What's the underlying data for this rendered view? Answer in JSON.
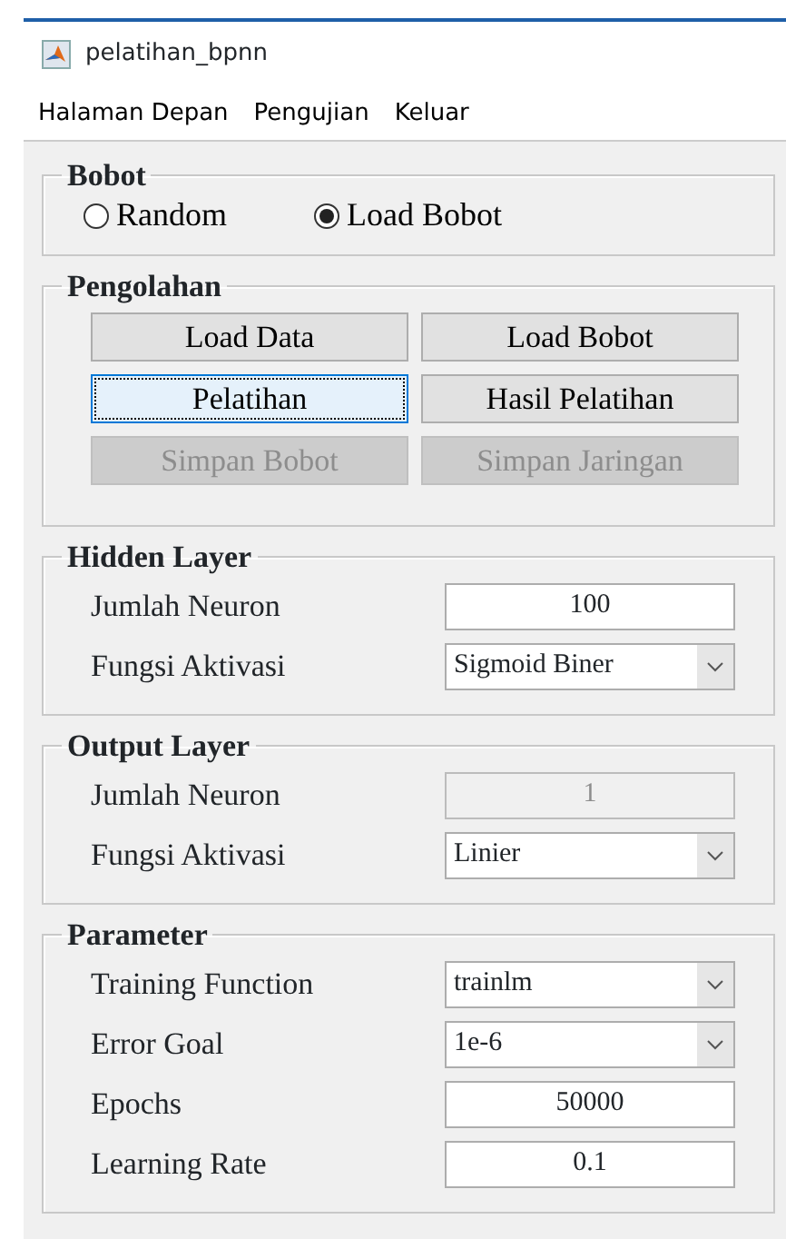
{
  "window": {
    "title": "pelatihan_bpnn"
  },
  "menu": [
    "Halaman Depan",
    "Pengujian",
    "Keluar"
  ],
  "panels": [
    {
      "title": "Bobot",
      "kind": "radios",
      "items": [
        {
          "label": "Random",
          "selected": false
        },
        {
          "label": "Load Bobot",
          "selected": true
        }
      ]
    },
    {
      "title": "Pengolahan",
      "kind": "buttons",
      "items": [
        {
          "label": "Load Data",
          "focused": false,
          "disabled": false
        },
        {
          "label": "Load Bobot",
          "focused": false,
          "disabled": false
        },
        {
          "label": "Pelatihan",
          "focused": true,
          "disabled": false
        },
        {
          "label": "Hasil Pelatihan",
          "focused": false,
          "disabled": false
        },
        {
          "label": "Simpan Bobot",
          "focused": false,
          "disabled": true
        },
        {
          "label": "Simpan Jaringan",
          "focused": false,
          "disabled": true
        }
      ]
    },
    {
      "title": "Hidden Layer",
      "kind": "fields",
      "items": [
        {
          "label": "Jumlah Neuron",
          "kind": "text",
          "value": "100",
          "disabled": false
        },
        {
          "label": "Fungsi Aktivasi",
          "kind": "dropdown",
          "value": "Sigmoid Biner",
          "disabled": false
        }
      ]
    },
    {
      "title": "Output Layer",
      "kind": "fields",
      "items": [
        {
          "label": "Jumlah Neuron",
          "kind": "text",
          "value": "1",
          "disabled": true
        },
        {
          "label": "Fungsi Aktivasi",
          "kind": "dropdown",
          "value": "Linier",
          "disabled": false
        }
      ]
    },
    {
      "title": "Parameter",
      "kind": "fields",
      "items": [
        {
          "label": "Training Function",
          "kind": "dropdown",
          "value": "trainlm",
          "disabled": false
        },
        {
          "label": "Error Goal",
          "kind": "dropdown",
          "value": "1e-6",
          "disabled": false
        },
        {
          "label": "Epochs",
          "kind": "text",
          "value": "50000",
          "disabled": false
        },
        {
          "label": "Learning Rate",
          "kind": "text",
          "value": "0.1",
          "disabled": false
        }
      ]
    }
  ]
}
